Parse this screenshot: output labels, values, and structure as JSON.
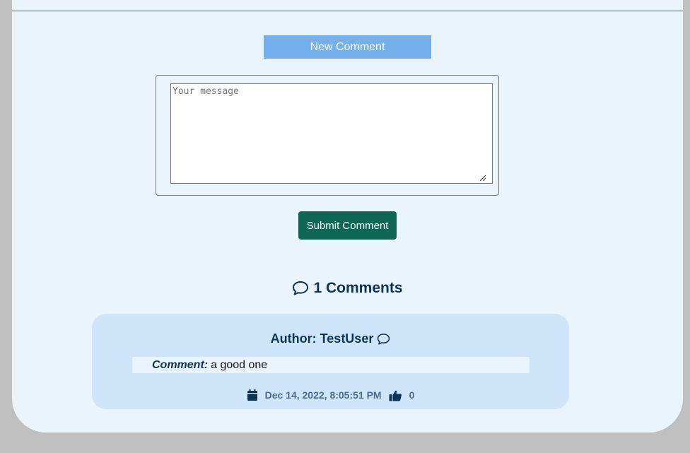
{
  "new_comment": {
    "title": "New Comment"
  },
  "form": {
    "placeholder": "Your message",
    "submit_label": "Submit Comment"
  },
  "comments_section": {
    "heading": "1 Comments"
  },
  "comments": [
    {
      "author_label": "Author: TestUser",
      "comment_label": "Comment:",
      "comment_text": "a good one",
      "date": "Dec 14, 2022, 8:05:51 PM",
      "likes": "0"
    }
  ],
  "colors": {
    "accent_bar": "#74b0ec",
    "submit_button": "#0e6655",
    "heading_text": "#0b3557",
    "card_bg": "#cfe5f9",
    "panel_bg": "#eaf4fd"
  },
  "icons": [
    "comment-icon",
    "calendar-icon",
    "thumbs-up-icon"
  ]
}
